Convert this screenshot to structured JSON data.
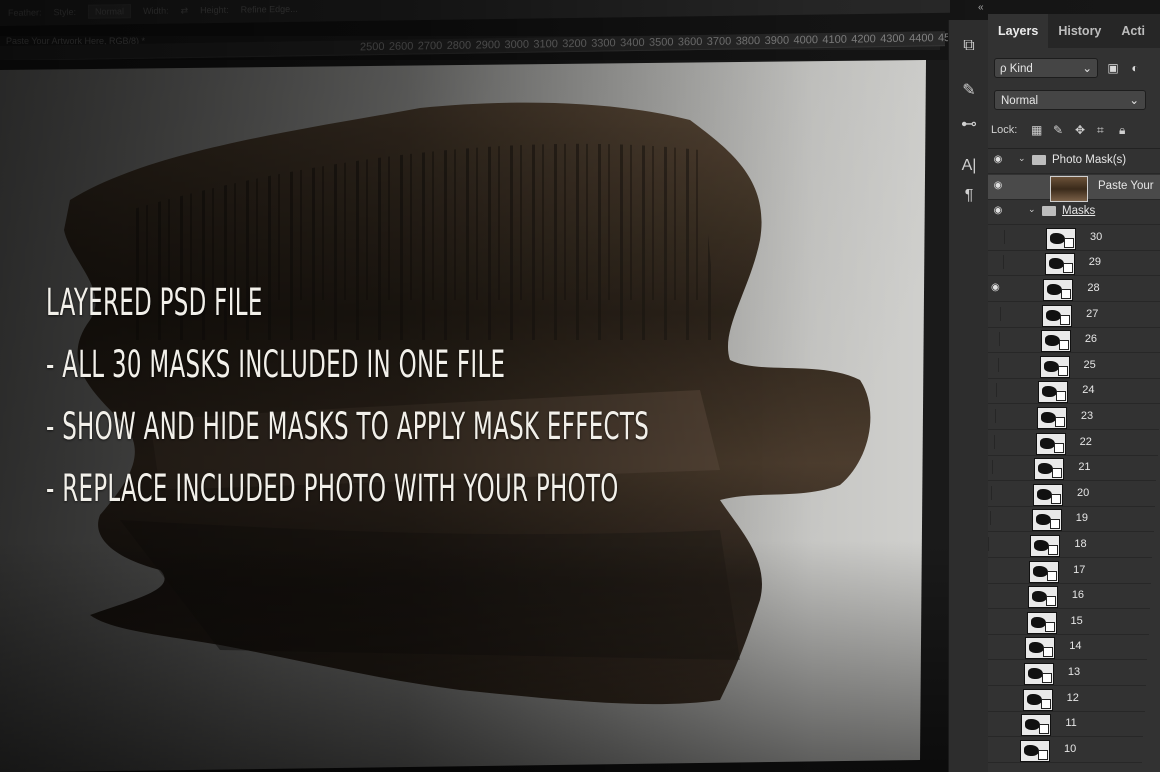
{
  "option_bar": {
    "items": [
      "Feather:",
      "Style:",
      "Normal",
      "Width:",
      "⇄",
      "Height:",
      "Refine Edge..."
    ]
  },
  "document_tab": "Paste Your Artwork Here, RGB/8) *",
  "ruler": {
    "labels": [
      "2500",
      "2600",
      "2700",
      "2800",
      "2900",
      "3000",
      "3100",
      "3200",
      "3300",
      "3400",
      "3500",
      "3600",
      "3700",
      "3800",
      "3900",
      "4000",
      "4100",
      "4200",
      "4300",
      "4400",
      "45"
    ]
  },
  "headline": {
    "lines": [
      "LAYERED PSD FILE",
      "- ALL 30 MASKS INCLUDED IN ONE FILE",
      "- SHOW AND HIDE MASKS TO APPLY MASK EFFECTS",
      "- REPLACE INCLUDED PHOTO WITH YOUR PHOTO"
    ]
  },
  "toolstrip": {
    "collapse_icon": "«",
    "tools": [
      {
        "name": "swap-icon",
        "glyph": "⧉"
      },
      {
        "name": "brush-preset-icon",
        "glyph": "✎"
      },
      {
        "name": "adjust-icon",
        "glyph": "⊷"
      },
      {
        "name": "character-icon",
        "glyph": "A|"
      },
      {
        "name": "paragraph-icon",
        "glyph": "¶"
      }
    ]
  },
  "panel": {
    "tabs": [
      "Layers",
      "History",
      "Acti"
    ],
    "active_tab": "Layers",
    "filter_kind": "ρ Kind",
    "blend_mode": "Normal",
    "lock_label": "Lock:",
    "layers": [
      {
        "type": "group",
        "name": "Photo Mask(s)",
        "visible": true,
        "indent": 0
      },
      {
        "type": "photo",
        "name": "Paste Your",
        "visible": true,
        "indent": 1
      },
      {
        "type": "group",
        "name": "Masks",
        "visible": true,
        "indent": 1
      },
      {
        "type": "mask",
        "name": "30",
        "visible": false
      },
      {
        "type": "mask",
        "name": "29",
        "visible": false
      },
      {
        "type": "mask",
        "name": "28",
        "visible": true
      },
      {
        "type": "mask",
        "name": "27",
        "visible": false
      },
      {
        "type": "mask",
        "name": "26",
        "visible": false
      },
      {
        "type": "mask",
        "name": "25",
        "visible": false
      },
      {
        "type": "mask",
        "name": "24",
        "visible": false
      },
      {
        "type": "mask",
        "name": "23",
        "visible": false
      },
      {
        "type": "mask",
        "name": "22",
        "visible": false
      },
      {
        "type": "mask",
        "name": "21",
        "visible": false
      },
      {
        "type": "mask",
        "name": "20",
        "visible": false
      },
      {
        "type": "mask",
        "name": "19",
        "visible": false
      },
      {
        "type": "mask",
        "name": "18",
        "visible": false
      },
      {
        "type": "mask",
        "name": "17",
        "visible": false
      },
      {
        "type": "mask",
        "name": "16",
        "visible": false
      },
      {
        "type": "mask",
        "name": "15",
        "visible": false
      },
      {
        "type": "mask",
        "name": "14",
        "visible": false
      },
      {
        "type": "mask",
        "name": "13",
        "visible": false
      },
      {
        "type": "mask",
        "name": "12",
        "visible": false
      },
      {
        "type": "mask",
        "name": "11",
        "visible": false
      },
      {
        "type": "mask",
        "name": "10",
        "visible": false
      }
    ]
  },
  "colors": {
    "panel_bg": "#323232",
    "canvas_paper": "#d7d7d3",
    "headline_text": "#f2f0ea"
  }
}
